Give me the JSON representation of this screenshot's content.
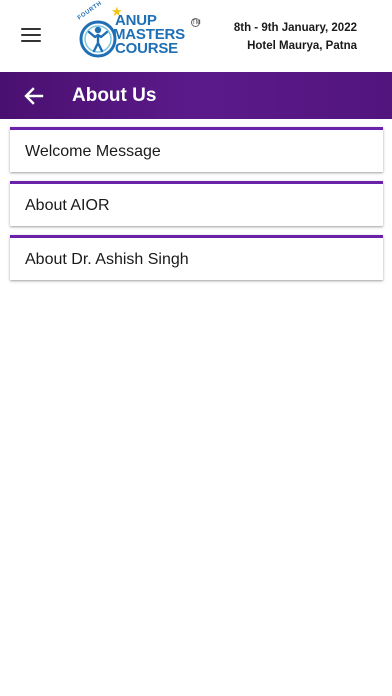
{
  "header": {
    "logo": {
      "prefix": "FOURTH",
      "line1": "ANUP",
      "line2": "MASTERS",
      "line3": "COURSE",
      "tm": "TM",
      "brand_color": "#1f6fb5",
      "star_color": "#f3c316"
    },
    "event_dates": "8th - 9th January, 2022",
    "event_venue": "Hotel Maurya, Patna",
    "menu_icon": "hamburger-menu-icon"
  },
  "titlebar": {
    "title": "About Us",
    "back_icon": "arrow-left-icon",
    "color": "#52157e"
  },
  "menu": {
    "items": [
      {
        "label": "Welcome Message"
      },
      {
        "label": "About AIOR"
      },
      {
        "label": "About Dr. Ashish Singh"
      }
    ],
    "accent_color": "#6a23a8"
  }
}
